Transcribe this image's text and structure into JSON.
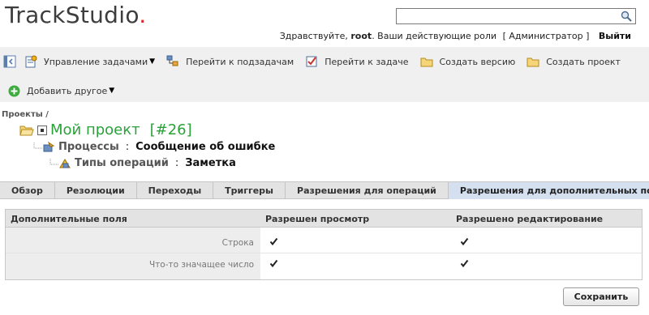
{
  "app": {
    "logo_main": "TrackStudio",
    "logo_dot": "."
  },
  "search": {
    "value": "",
    "placeholder": ""
  },
  "user": {
    "greeting": "Здравствуйте,",
    "name": "root",
    "roles_label": ". Ваши действующие роли",
    "role": "[ Администратор ]",
    "exit": "Выйти"
  },
  "toolbar": {
    "row1": [
      {
        "label": "Управление задачами",
        "icon": "task-manage-icon",
        "dropdown": true
      },
      {
        "label": "Перейти к подзадачам",
        "icon": "subtasks-icon"
      },
      {
        "label": "Перейти к задаче",
        "icon": "goto-task-icon"
      },
      {
        "label": "Создать версию",
        "icon": "folder-icon"
      },
      {
        "label": "Создать проект",
        "icon": "folder-icon"
      }
    ],
    "add_other": "Добавить другое"
  },
  "breadcrumb": "Проекты /",
  "project": {
    "title": "Мой проект",
    "number": "[#26]"
  },
  "path": [
    {
      "label": "Процессы",
      "value": "Сообщение об ошибке"
    },
    {
      "label": "Типы операций",
      "value": "Заметка"
    }
  ],
  "tabs": [
    {
      "label": "Обзор"
    },
    {
      "label": "Резолюции"
    },
    {
      "label": "Переходы"
    },
    {
      "label": "Триггеры"
    },
    {
      "label": "Разрешения для операций"
    },
    {
      "label": "Разрешения для дополнительных полей",
      "active": true
    }
  ],
  "table": {
    "headers": [
      "Дополнительные поля",
      "Разрешен просмотр",
      "Разрешено редактирование"
    ],
    "rows": [
      {
        "name": "Строка",
        "view": true,
        "edit": true
      },
      {
        "name": "Что-то значащее число",
        "view": true,
        "edit": true
      }
    ]
  },
  "save_label": "Сохранить",
  "colors": {
    "accent_green": "#2aa23a",
    "logo_dot": "#e0262a",
    "active_tab": "#d4e0ef"
  }
}
